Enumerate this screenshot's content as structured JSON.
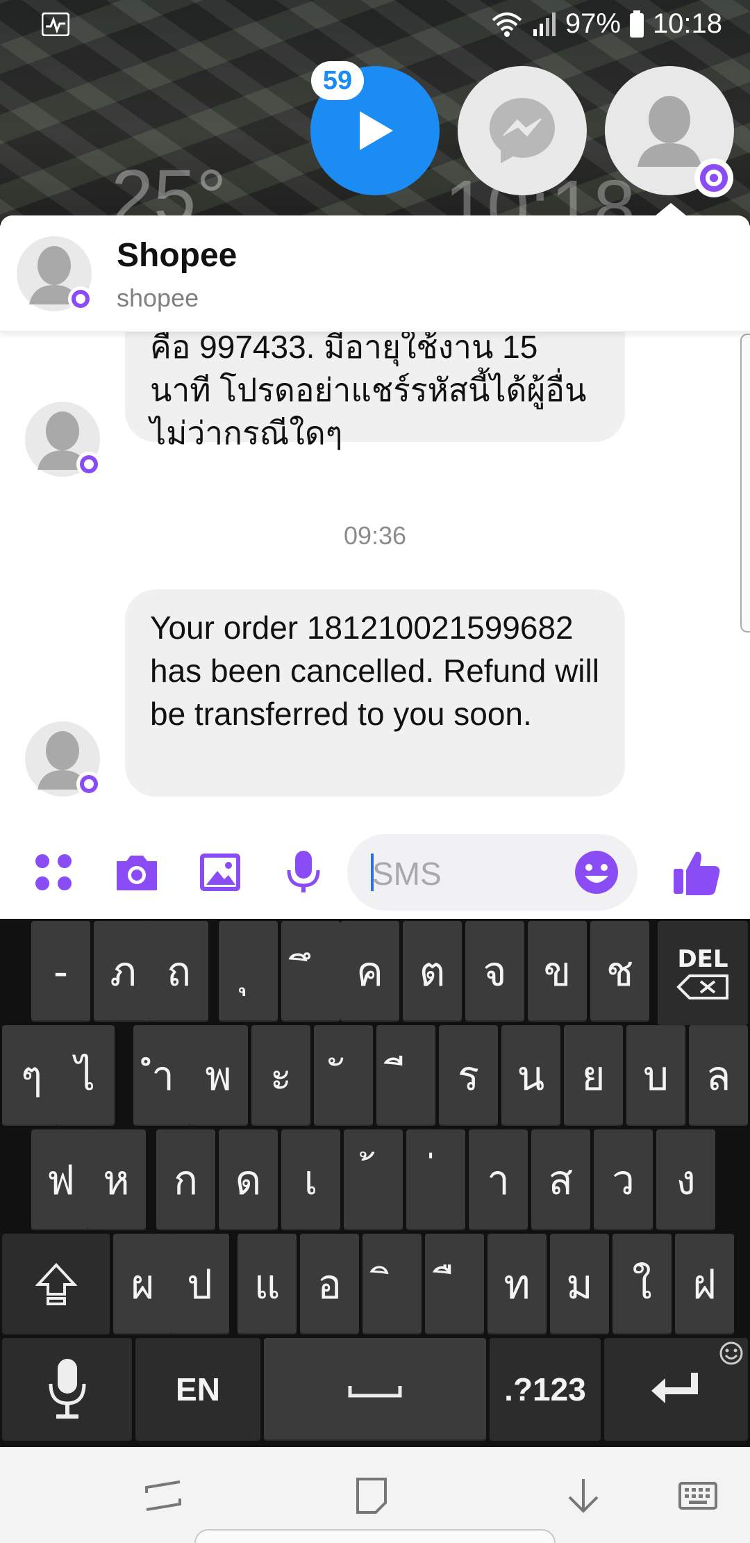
{
  "status_bar": {
    "battery": "97%",
    "time": "10:18"
  },
  "wallpaper": {
    "weather_text": "25°",
    "clock_text": "10:18"
  },
  "chat_heads": {
    "video_badge_count": "59"
  },
  "header": {
    "title": "Shopee",
    "subtitle": "shopee"
  },
  "messages": [
    {
      "text": "คือ 997433. มีอายุใช้งาน 15 นาที โปรดอย่าแชร์รหัสนี้ได้ผู้อื่นไม่ว่ากรณีใดๆ"
    },
    {
      "timestamp": "09:36"
    },
    {
      "text": "Your order 181210021599682 has been cancelled. Refund will be transferred to you soon."
    }
  ],
  "composer": {
    "placeholder": "SMS"
  },
  "keyboard": {
    "row1": [
      "-",
      "ภ",
      "ถ",
      "ุ",
      "ึ",
      "ค",
      "ต",
      "จ",
      "ข",
      "ช"
    ],
    "row2": [
      "ๆ",
      "ไ",
      "ำ",
      "พ",
      "ะ",
      "ั",
      "ี",
      "ร",
      "น",
      "ย",
      "บ",
      "ล"
    ],
    "row3": [
      "ฟ",
      "ห",
      "ก",
      "ด",
      "เ",
      "้",
      "่",
      "า",
      "ส",
      "ว",
      "ง"
    ],
    "row4": [
      "ผ",
      "ป",
      "แ",
      "อ",
      "ิ",
      "ื",
      "ท",
      "ม",
      "ใ",
      "ฝ"
    ],
    "del_label": "DEL",
    "lang_label": "EN",
    "sym_label": ".?123"
  },
  "colors": {
    "accent": "#8a4cf5",
    "messenger_blue": "#1a8cf3"
  }
}
